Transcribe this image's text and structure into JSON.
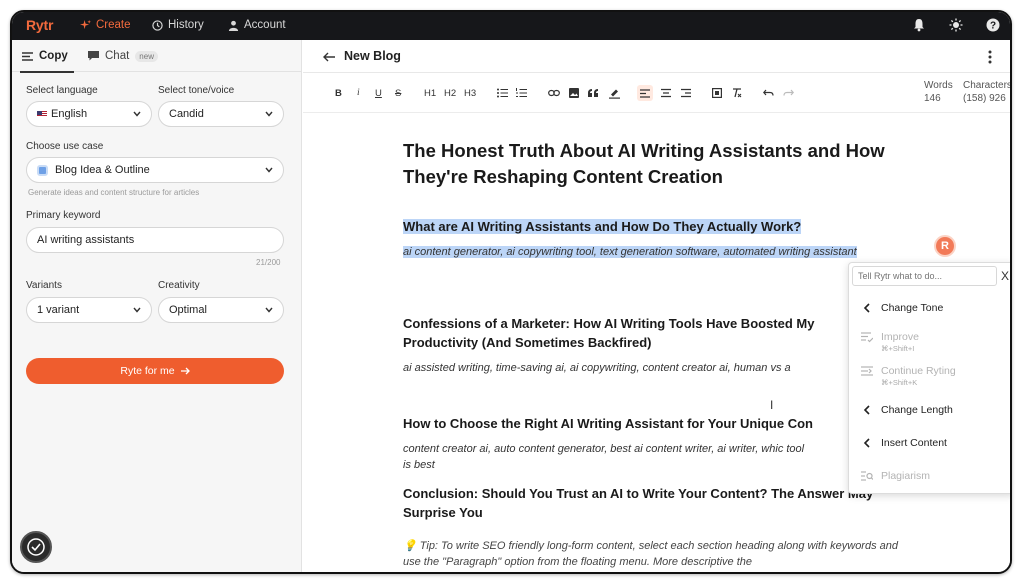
{
  "app": {
    "logo": "Rytr",
    "nav": [
      {
        "label": "Create",
        "icon": "sparkle-icon",
        "active": true
      },
      {
        "label": "History",
        "icon": "clock-icon",
        "active": false
      },
      {
        "label": "Account",
        "icon": "user-icon",
        "active": false
      }
    ],
    "top_icons": [
      "bell-icon",
      "sun-icon",
      "help-icon"
    ],
    "accent": "#ef5d2e"
  },
  "sidebar": {
    "tabs": [
      {
        "label": "Copy",
        "active": true
      },
      {
        "label": "Chat",
        "badge": "new",
        "active": false
      }
    ],
    "language": {
      "label": "Select language",
      "value": "English"
    },
    "tone": {
      "label": "Select tone/voice",
      "value": "Candid"
    },
    "use_case": {
      "label": "Choose use case",
      "value": "Blog Idea & Outline",
      "hint": "Generate ideas and content structure for articles"
    },
    "keyword": {
      "label": "Primary keyword",
      "value": "AI writing assistants",
      "counter": "21/200"
    },
    "variants": {
      "label": "Variants",
      "value": "1 variant"
    },
    "creativity": {
      "label": "Creativity",
      "value": "Optimal"
    },
    "ryte_button": "Ryte for me"
  },
  "document": {
    "title": "New Blog",
    "toolbar": [
      "B",
      "i",
      "U",
      "S",
      "H1",
      "H2",
      "H3"
    ],
    "stats": {
      "words_label": "Words",
      "words": "146",
      "chars_label": "Characters",
      "chars": "(158) 926"
    },
    "h1": "The Honest Truth About AI Writing Assistants and How They're Reshaping Content Creation",
    "sections": [
      {
        "heading": "What are AI Writing Assistants and How Do They Actually Work?",
        "keywords": "ai content generator, ai copywriting tool, text generation software, automated writing assistant"
      },
      {
        "heading": "Confessions of a Marketer: How AI Writing Tools Have Boosted My Productivity (And Sometimes Backfired)",
        "keywords": "ai assisted writing, time-saving ai, ai copywriting, content creator ai, human vs a"
      },
      {
        "heading": "How to Choose the Right AI Writing Assistant for Your Unique Con",
        "keywords": "content creator ai, auto content generator, best ai content writer, ai writer, whic tool is best"
      },
      {
        "heading": "Conclusion: Should You Trust an AI to Write Your Content? The Answer May Surprise You",
        "keywords": ""
      }
    ],
    "tip": "💡 Tip: To write SEO friendly long-form content, select each section heading along with keywords and use the \"Paragraph\" option from the floating menu. More descriptive the"
  },
  "avatar_letter": "R",
  "floating_menu": {
    "placeholder": "Tell Rytr what to do...",
    "close": "X",
    "items": [
      {
        "label": "Change Tone",
        "icon": "chevron-left-icon",
        "shortcut": "",
        "disabled": false
      },
      {
        "label": "Improve",
        "icon": "improve-icon",
        "shortcut": "⌘+Shift+I",
        "disabled": true
      },
      {
        "label": "Continue Ryting",
        "icon": "continue-icon",
        "shortcut": "⌘+Shift+K",
        "disabled": true
      },
      {
        "label": "Change Length",
        "icon": "chevron-left-icon",
        "shortcut": "",
        "disabled": false
      },
      {
        "label": "Insert Content",
        "icon": "chevron-left-icon",
        "shortcut": "",
        "disabled": false
      },
      {
        "label": "Plagiarism",
        "icon": "plagiarism-icon",
        "shortcut": "",
        "disabled": true
      }
    ]
  }
}
